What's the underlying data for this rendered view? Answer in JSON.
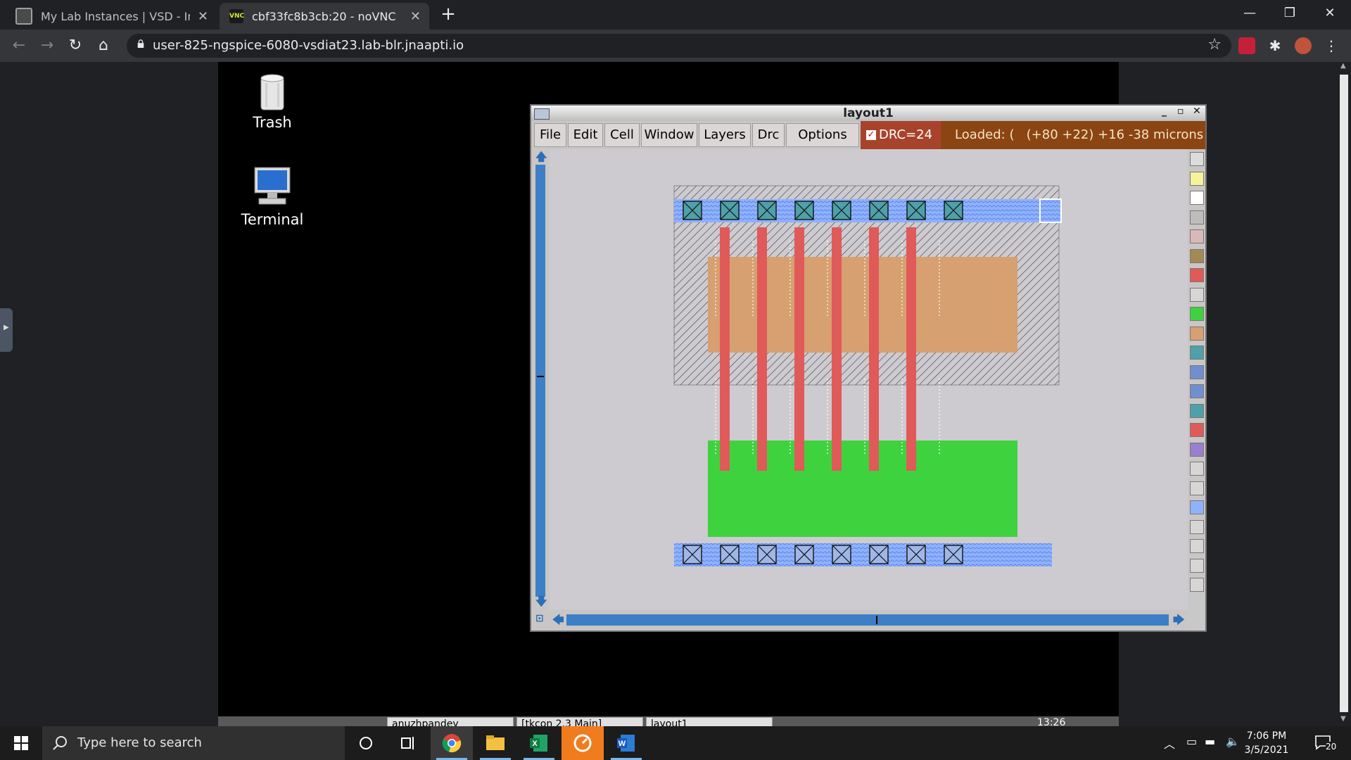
{
  "browser": {
    "tabs": [
      {
        "title": "My Lab Instances | VSD - Intellig",
        "active": false
      },
      {
        "title": "cbf33fc8b3cb:20 - noVNC",
        "active": true
      }
    ],
    "address_url": "user-825-ngspice-6080-vsdiat23.lab-blr.jnaapti.io",
    "new_tab": "+",
    "icons": [
      "back-icon",
      "forward-icon",
      "reload-icon",
      "home-icon",
      "lock-icon",
      "star-icon",
      "extension-icon",
      "puzzle-icon",
      "profile-icon",
      "menu-icon"
    ]
  },
  "desktop": {
    "icons": [
      {
        "label": "Trash"
      },
      {
        "label": "Terminal"
      }
    ]
  },
  "magic_window": {
    "title": "layout1",
    "menu": [
      "File",
      "Edit",
      "Cell",
      "Window",
      "Layers",
      "Drc",
      "Options"
    ],
    "drc_label": "DRC=24",
    "drc_checked": true,
    "status_text": "Loaded: (   (+80 +22) +16 -38 microns"
  },
  "layout_colors": {
    "metal1_blue": "#7fa8f0",
    "poly_red": "#e05a5a",
    "pdiff_tan": "#d6a070",
    "ndiff_green": "#3fd23f",
    "nwell_hatch": "#555555",
    "background": "#cdcbcf"
  },
  "x_taskbar": {
    "items": [
      "anuzhpandey",
      "[tkcon 2.3 Main]",
      "layout1"
    ],
    "clock": "13:26"
  },
  "win_taskbar": {
    "search_placeholder": "Type here to search",
    "time": "7:06 PM",
    "date": "3/5/2021",
    "notification_count": "20",
    "apps": [
      "cortana-icon",
      "task-view-icon",
      "chrome-icon",
      "file-explorer-icon",
      "excel-icon",
      "app-orange-icon",
      "word-icon"
    ]
  }
}
